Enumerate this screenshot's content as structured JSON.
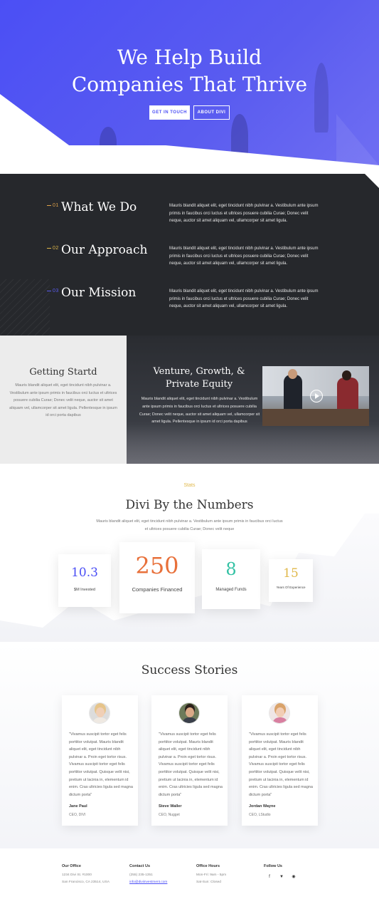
{
  "hero": {
    "title_line1": "We Help Build",
    "title_line2": "Companies That Thrive",
    "primary_button": "GET IN TOUCH",
    "secondary_button": "ABOUT DIVI"
  },
  "services": {
    "items": [
      {
        "num": "01",
        "title": "What We Do",
        "text": "Mauris blandit aliquet elit, eget tincidunt nibh pulvinar a. Vestibulum ante ipsum primis in faucibus orci luctus et ultrices posuere cubilia Curae; Donec velit neque, auctor sit amet aliquam vel, ullamcorper sit amet ligula.",
        "color": "#e0a24a"
      },
      {
        "num": "02",
        "title": "Our Approach",
        "text": "Mauris blandit aliquet elit, eget tincidunt nibh pulvinar a. Vestibulum ante ipsum primis in faucibus orci luctus et ultrices posuere cubilia Curae; Donec velit neque, auctor sit amet aliquam vel, ullamcorper sit amet ligula.",
        "color": "#e0b84a"
      },
      {
        "num": "03",
        "title": "Our Mission",
        "text": "Mauris blandit aliquet elit, eget tincidunt nibh pulvinar a. Vestibulum ante ipsum primis in faucibus orci luctus et ultrices posuere cubilia Curae; Donec velit neque, auctor sit amet aliquam vel, ullamcorper sit amet ligula.",
        "color": "#5a5cf0"
      }
    ]
  },
  "getting_started": {
    "title": "Getting Startd",
    "text": "Mauris blandit aliquet elit, eget tincidunt nibh pulvinar a. Vestibulum ante ipsum primis in faucibus orci luctus et ultrices posuere cubilia Curae; Donec velit neque, auctor sit amet aliquam vel, ullamcorper sit amet ligula. Pellentesque in ipsum id orci porta dapibus"
  },
  "venture": {
    "title_line1": "Venture, Growth, &",
    "title_line2": "Private Equity",
    "text": "Mauris blandit aliquet elit, eget tincidunt nibh pulvinar a. Vestibulum ante ipsum primis in faucibus orci luctus et ultrices posuere cubilia Curae; Donec velit neque, auctor sit amet aliquam vel, ullamcorper sit amet ligula. Pellentesque in ipsum id orci porta dapibus"
  },
  "stats": {
    "label": "Stats",
    "title": "Divi By the Numbers",
    "subtitle": "Mauris blandit aliquet elit, eget tincidunt nibh pulvinar a. Vestibulum ante ipsum primis in faucibus orci luctus et ultrices posuere cubilia Curae; Donec velit neque",
    "cards": [
      {
        "value": "10.3",
        "caption": "$M Invested",
        "color": "#4b4ff5"
      },
      {
        "value": "250",
        "caption": "Companies Financed",
        "color": "#e8703a"
      },
      {
        "value": "8",
        "caption": "Managed Funds",
        "color": "#35c2a5"
      },
      {
        "value": "15",
        "caption": "Years Of Experience",
        "color": "#e0b84a"
      }
    ]
  },
  "success": {
    "title": "Success Stories",
    "testimonials": [
      {
        "quote": "\"Vivamus suscipit tortor eget felis porttitor volutpat. Mauris blandit aliquet elit, eget tincidunt nibh pulvinar a. Proin eget tortor risus. Vivamus suscipit tortor eget felis porttitor volutpat. Quisque velit nisi, pretium ut lacinia in, elementum id enim. Cras ultricies ligula sed magna dictum porta\"",
        "name": "Jane Paul",
        "role": "CEO, DIVI"
      },
      {
        "quote": "\"Vivamus suscipit tortor eget felis porttitor volutpat. Mauris blandit aliquet elit, eget tincidunt nibh pulvinar a. Proin eget tortor risus. Vivamus suscipit tortor eget felis porttitor volutpat. Quisque velit nisi, pretium ut lacinia in, elementum id enim. Cras ultricies ligula sed magna dictum porta\"",
        "name": "Steve Waller",
        "role": "CEO, Nugget"
      },
      {
        "quote": "\"Vivamus suscipit tortor eget felis porttitor volutpat. Mauris blandit aliquet elit, eget tincidunt nibh pulvinar a. Proin eget tortor risus. Vivamus suscipit tortor eget felis porttitor volutpat. Quisque velit nisi, pretium ut lacinia in, elementum id enim. Cras ultricies ligula sed magna dictum porta\"",
        "name": "Jordan Wayne",
        "role": "CEO, LStudio"
      }
    ]
  },
  "footer": {
    "office": {
      "heading": "Our Office",
      "line1": "1234 Divi St. #1000",
      "line2": "San Francisco, CA 23514, USA"
    },
    "contact": {
      "heading": "Contact Us",
      "phone": "(255) 235-1351",
      "email": "info@diviinvestment.com"
    },
    "hours": {
      "heading": "Office Hours",
      "line1": "Mon-Fri: 9am - 5pm",
      "line2": "Sat-Sun: Closed"
    },
    "follow": {
      "heading": "Follow Us",
      "icons": [
        "facebook-icon",
        "twitter-icon",
        "instagram-icon"
      ]
    }
  }
}
